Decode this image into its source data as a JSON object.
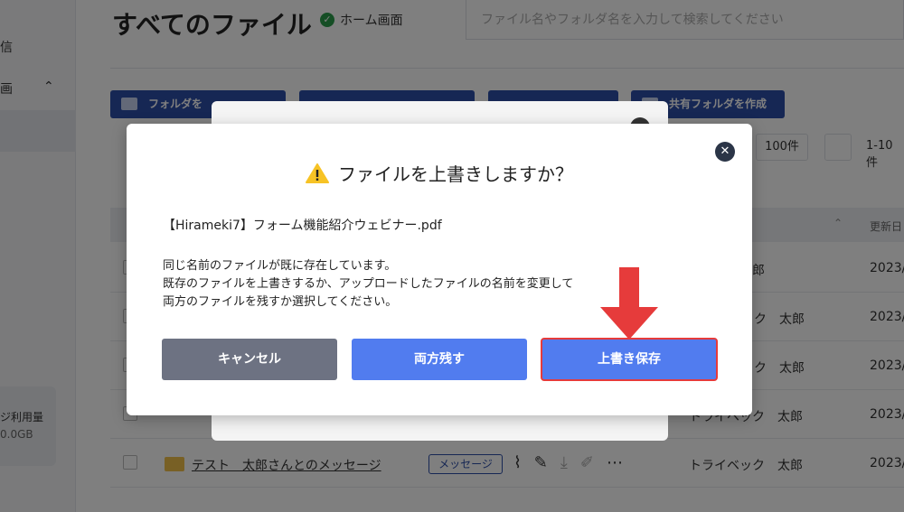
{
  "sidebar": {
    "item_partial_1": "信",
    "item_partial_2": "画",
    "storage_label": "ジ利用量",
    "storage_value": "0.0GB"
  },
  "header": {
    "title": "すべてのファイル",
    "home_label": "ホーム画面",
    "search_placeholder": "ファイル名やフォルダ名を入力して検索してください"
  },
  "toolbar": {
    "create_folder_label": "フォルダを",
    "create_shared_folder_label": "共有フォルダを作成"
  },
  "pager": {
    "per_page": "100件",
    "range": "1-10件"
  },
  "table": {
    "date_header": "更新日",
    "rows": [
      {
        "owner": "郎",
        "date": "2023/"
      },
      {
        "owner": "ック　太郎",
        "date": "2023/"
      },
      {
        "owner": "ック　太郎",
        "date": "2023/"
      },
      {
        "owner": "トライベック　太郎",
        "date": "2023/"
      },
      {
        "owner": "トライベック　太郎",
        "date": "2023/",
        "title": "テスト　太郎さんとのメッセージ",
        "badge": "メッセージ"
      }
    ]
  },
  "dialog": {
    "title": "ファイルを上書きしますか？",
    "file_name": "【Hirameki7】フォーム機能紹介ウェビナー.pdf",
    "message_line1": "同じ名前のファイルが既に存在しています。",
    "message_line2": "既存のファイルを上書きするか、アップロードしたファイルの名前を変更して",
    "message_line3": "両方のファイルを残すか選択してください。",
    "cancel_label": "キャンセル",
    "keep_both_label": "両方残す",
    "overwrite_label": "上書き保存",
    "close_glyph": "✕"
  },
  "colors": {
    "primary": "#517cef",
    "cancel": "#6d7282",
    "highlight_arrow": "#e63b3b",
    "warning": "#f7c325"
  }
}
